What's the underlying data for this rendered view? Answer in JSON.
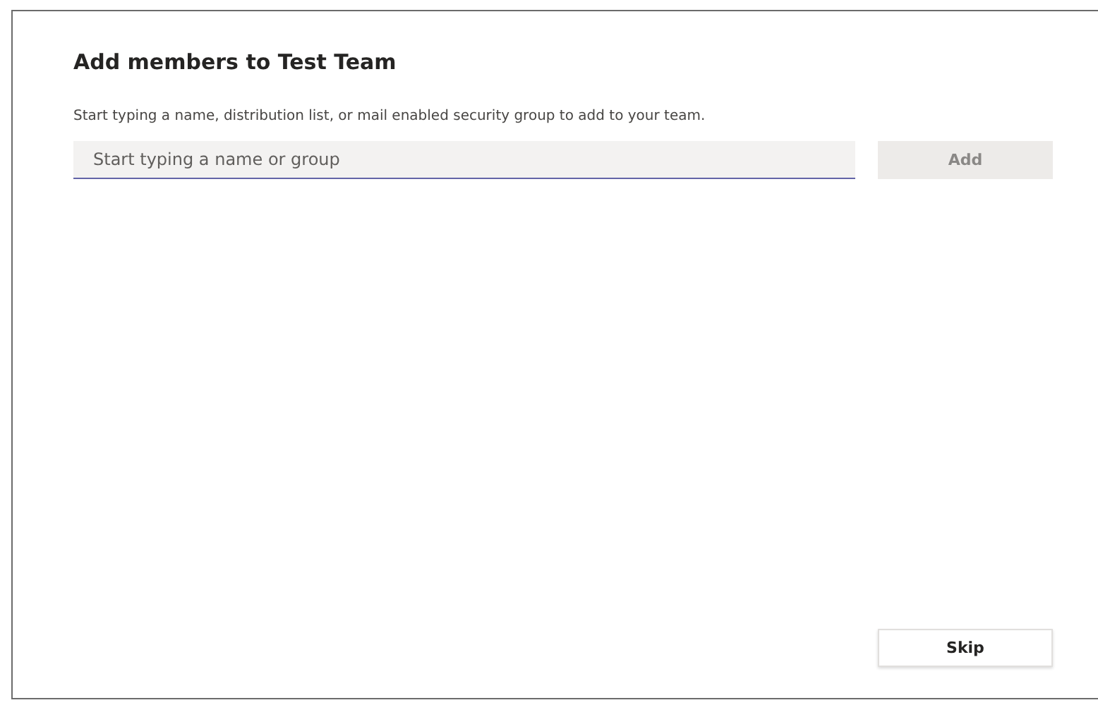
{
  "dialog": {
    "title": "Add members to Test Team",
    "description": "Start typing a name, distribution list, or mail enabled security group to add to your team.",
    "search": {
      "placeholder": "Start typing a name or group"
    },
    "add_button": {
      "label": "Add",
      "disabled": true
    },
    "skip_button": {
      "label": "Skip",
      "disabled": false
    }
  }
}
